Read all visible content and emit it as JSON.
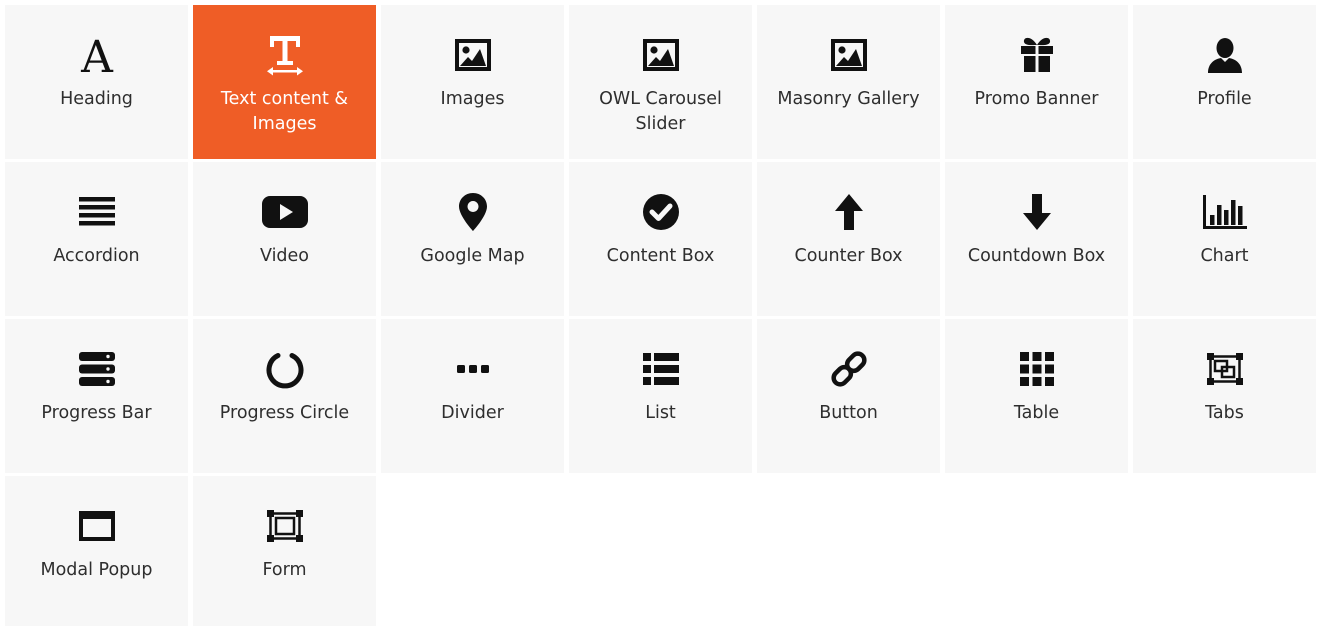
{
  "accent_color": "#ef5d26",
  "tiles": [
    {
      "label": "Heading",
      "icon": "heading-icon",
      "active": false
    },
    {
      "label": "Text content & Images",
      "icon": "text-content-icon",
      "active": true
    },
    {
      "label": "Images",
      "icon": "image-icon",
      "active": false
    },
    {
      "label": "OWL Carousel Slider",
      "icon": "image-icon",
      "active": false
    },
    {
      "label": "Masonry Gallery",
      "icon": "image-icon",
      "active": false
    },
    {
      "label": "Promo Banner",
      "icon": "gift-icon",
      "active": false
    },
    {
      "label": "Profile",
      "icon": "user-icon",
      "active": false
    },
    {
      "label": "Accordion",
      "icon": "bars-icon",
      "active": false
    },
    {
      "label": "Video",
      "icon": "youtube-play-icon",
      "active": false
    },
    {
      "label": "Google Map",
      "icon": "map-marker-icon",
      "active": false
    },
    {
      "label": "Content Box",
      "icon": "check-circle-icon",
      "active": false
    },
    {
      "label": "Counter Box",
      "icon": "arrow-up-icon",
      "active": false
    },
    {
      "label": "Countdown Box",
      "icon": "arrow-down-icon",
      "active": false
    },
    {
      "label": "Chart",
      "icon": "bar-chart-icon",
      "active": false
    },
    {
      "label": "Progress Bar",
      "icon": "server-icon",
      "active": false
    },
    {
      "label": "Progress Circle",
      "icon": "circle-notch-icon",
      "active": false
    },
    {
      "label": "Divider",
      "icon": "ellipsis-icon",
      "active": false
    },
    {
      "label": "List",
      "icon": "list-icon",
      "active": false
    },
    {
      "label": "Button",
      "icon": "link-icon",
      "active": false
    },
    {
      "label": "Table",
      "icon": "th-icon",
      "active": false
    },
    {
      "label": "Tabs",
      "icon": "object-group-icon",
      "active": false
    },
    {
      "label": "Modal Popup",
      "icon": "window-icon",
      "active": false
    },
    {
      "label": "Form",
      "icon": "object-ungroup-icon",
      "active": false
    }
  ]
}
